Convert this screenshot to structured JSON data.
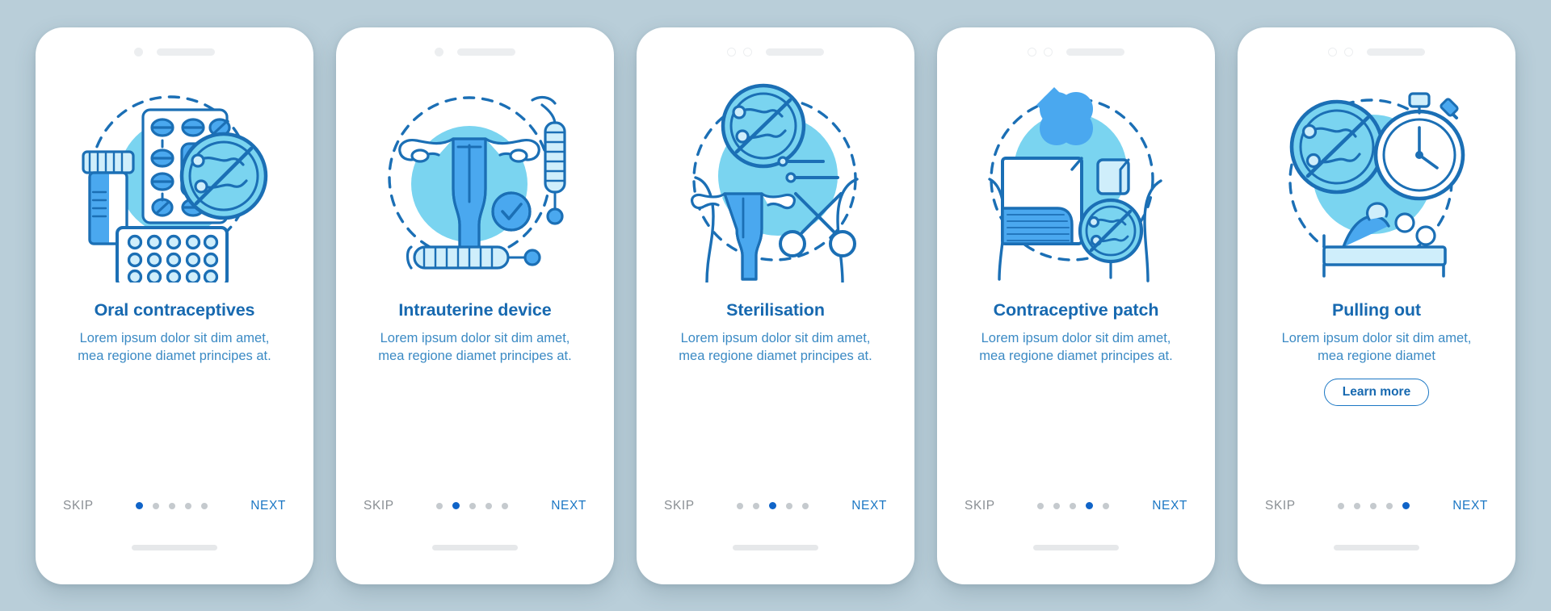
{
  "background_color": "#b9ced9",
  "palette": {
    "title_blue": "#1769b0",
    "body_blue": "#3b8ac4",
    "accent_blue": "#1b77c4",
    "active_dot": "#1064c8",
    "skip_gray": "#8a8f94",
    "inactive_dot": "#c5cace",
    "illus_fill_light": "#7ad4f0",
    "illus_fill_mid": "#4aa8ef",
    "illus_stroke": "#1b6fb5"
  },
  "nav_common": {
    "skip_label": "SKIP",
    "next_label": "NEXT",
    "dot_count": 5
  },
  "screens": [
    {
      "id": "oral-contraceptives",
      "top_dots": "one-filled",
      "illustration_name": "pill-bottle-blister-pack-no-sperm-icon",
      "title": "Oral contraceptives",
      "body": "Lorem ipsum dolor sit dim amet, mea regione diamet principes at.",
      "active_dot_index": 0,
      "learn_more": null
    },
    {
      "id": "intrauterine-device",
      "top_dots": "one-filled",
      "illustration_name": "uterus-iud-checkmark-icon",
      "title": "Intrauterine device",
      "body": "Lorem ipsum dolor sit dim amet, mea regione diamet principes at.",
      "active_dot_index": 1,
      "learn_more": null
    },
    {
      "id": "sterilisation",
      "top_dots": "two-rings",
      "illustration_name": "uterus-scissors-no-sperm-icon",
      "title": "Sterilisation",
      "body": "Lorem ipsum dolor sit dim amet, mea regione diamet principes at.",
      "active_dot_index": 2,
      "learn_more": null
    },
    {
      "id": "contraceptive-patch",
      "top_dots": "two-rings",
      "illustration_name": "adhesive-patch-no-sperm-icon",
      "title": "Contraceptive patch",
      "body": "Lorem ipsum dolor sit dim amet, mea regione diamet principes at.",
      "active_dot_index": 3,
      "learn_more": null
    },
    {
      "id": "pulling-out",
      "top_dots": "two-rings",
      "illustration_name": "no-sperm-stopwatch-couple-icon",
      "title": "Pulling out",
      "body": "Lorem ipsum dolor sit dim amet, mea regione diamet",
      "active_dot_index": 4,
      "learn_more": "Learn more"
    }
  ]
}
